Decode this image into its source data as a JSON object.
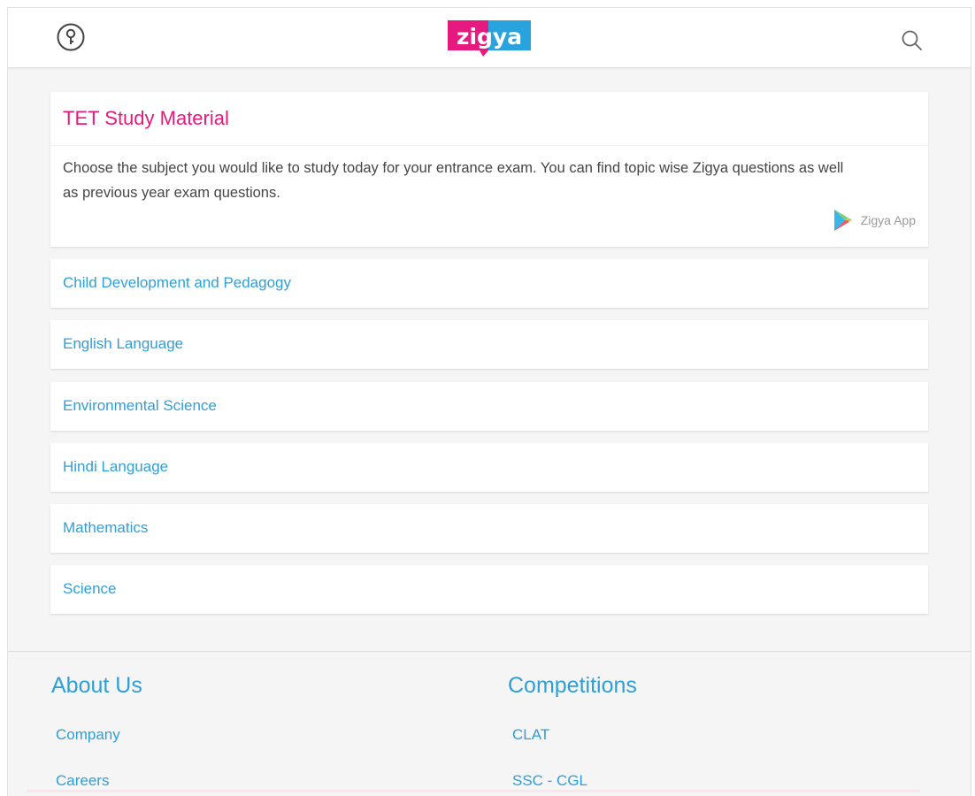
{
  "header": {
    "logo_text": "zigya",
    "help_icon": "help-circle-icon",
    "search_icon": "search-icon"
  },
  "intro": {
    "title": "TET Study Material",
    "description": "Choose the subject you would like to study today for your entrance exam. You can find topic wise Zigya questions as well as previous year exam questions.",
    "app_link_label": "Zigya App",
    "app_icon": "play-store-icon"
  },
  "subjects": [
    {
      "label": "Child Development and Pedagogy"
    },
    {
      "label": "English Language"
    },
    {
      "label": "Environmental Science"
    },
    {
      "label": "Hindi Language"
    },
    {
      "label": "Mathematics"
    },
    {
      "label": "Science"
    }
  ],
  "footer": {
    "about": {
      "heading": "About Us",
      "links": [
        "Company",
        "Careers"
      ]
    },
    "competitions": {
      "heading": "Competitions",
      "links": [
        "CLAT",
        "SSC - CGL"
      ]
    }
  },
  "colors": {
    "brand_pink": "#e6197e",
    "brand_blue": "#2f9fd8",
    "background": "#f5f5f5"
  }
}
